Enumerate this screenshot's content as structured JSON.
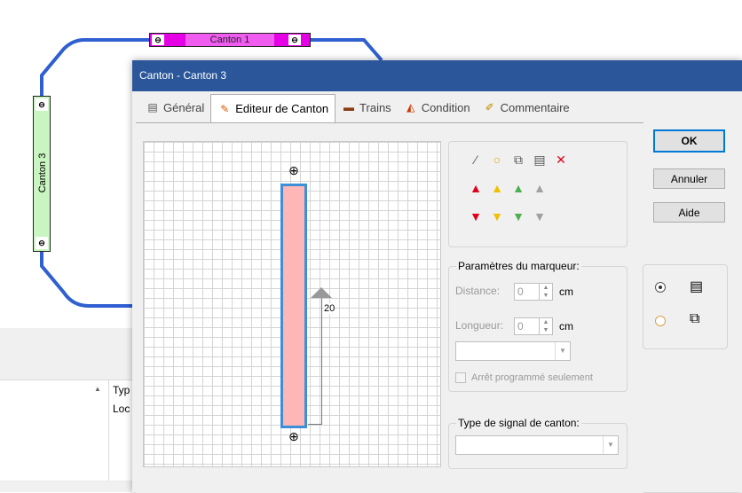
{
  "background": {
    "cantons": {
      "top": {
        "label": "Canton 1",
        "color": "#e600e6"
      },
      "left": {
        "label": "Canton 3",
        "color": "#c9f5c0"
      }
    },
    "track_color": "#2f5fd0",
    "list": {
      "column_header": "Typ",
      "rows": [
        "Loc",
        "",
        "",
        "",
        "",
        ""
      ]
    }
  },
  "dialog": {
    "title": "Canton - Canton 3",
    "tabs": [
      {
        "label": "Général",
        "icon": "general-icon"
      },
      {
        "label": "Editeur de Canton",
        "icon": "editor-icon",
        "active": true
      },
      {
        "label": "Trains",
        "icon": "trains-icon"
      },
      {
        "label": "Condition",
        "icon": "condition-icon"
      },
      {
        "label": "Commentaire",
        "icon": "comment-icon"
      }
    ],
    "editor": {
      "marker_value": "20",
      "block_color": "#ffb6b6",
      "block_border": "#3c8fd8"
    },
    "toolbar": {
      "row1": [
        "magic-wand-icon",
        "circle-icon",
        "copy-icon",
        "properties-icon",
        "delete-icon"
      ],
      "up_arrows": [
        "#e0001b",
        "#f0c000",
        "#4caf50",
        "#a0a0a0"
      ],
      "down_arrows": [
        "#e0001b",
        "#f0c000",
        "#4caf50",
        "#a0a0a0"
      ]
    },
    "marker_params": {
      "title": "Paramètres du marqueur:",
      "distance_label": "Distance:",
      "distance_value": "0",
      "length_label": "Longueur:",
      "length_value": "0",
      "unit": "cm",
      "checkbox_label": "Arrêt programmé seulement"
    },
    "signal_type": {
      "title": "Type de signal de canton:"
    },
    "buttons": {
      "ok": "OK",
      "cancel": "Annuler",
      "help": "Aide"
    }
  }
}
